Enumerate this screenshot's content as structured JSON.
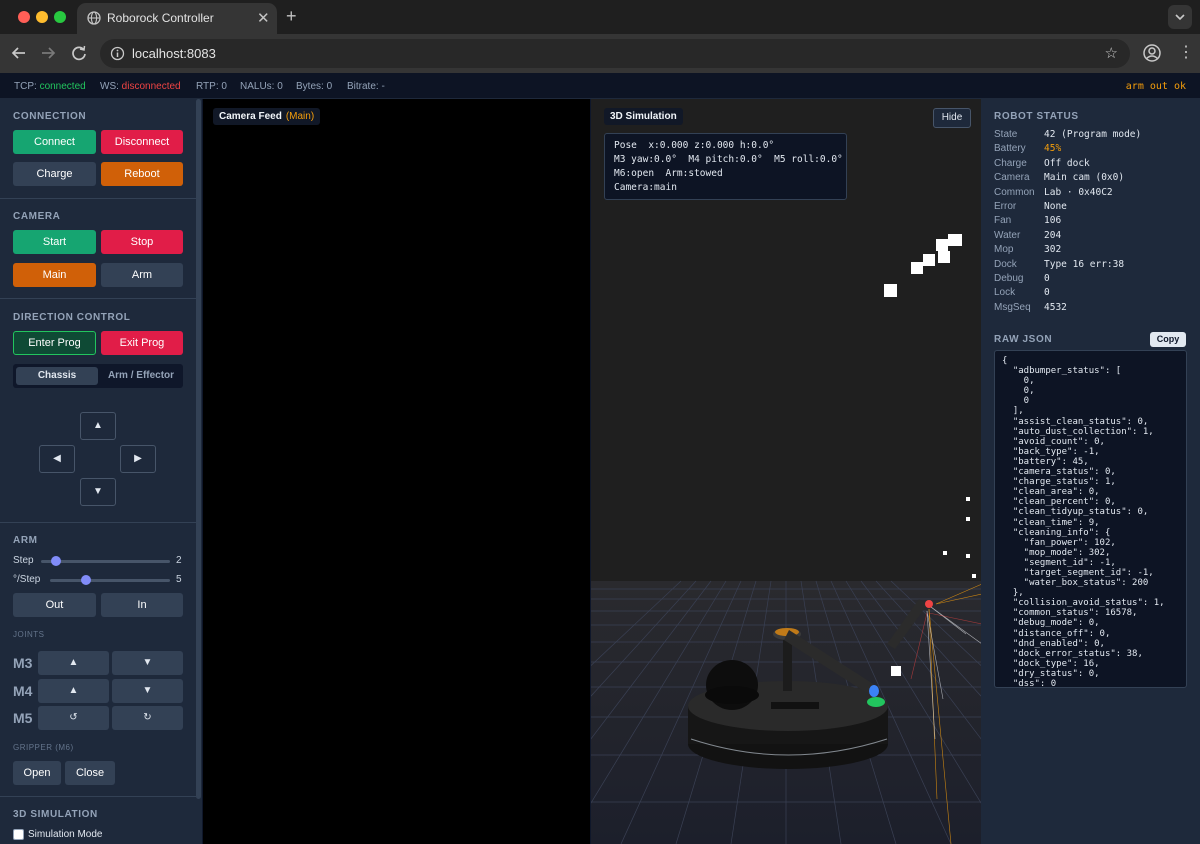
{
  "browser": {
    "tab_title": "Roborock Controller",
    "url": "localhost:8083",
    "tab_close": "✕",
    "new_tab": "+"
  },
  "statusbar": {
    "tcp_label": "TCP:",
    "tcp_value": "connected",
    "ws_label": "WS:",
    "ws_value": "disconnected",
    "rtp": "RTP: 0",
    "nalus": "NALUs: 0",
    "bytes": "Bytes: 0",
    "bitrate": "Bitrate: -",
    "arm_status": "arm out ok"
  },
  "connection": {
    "title": "CONNECTION",
    "connect": "Connect",
    "disconnect": "Disconnect",
    "charge": "Charge",
    "reboot": "Reboot"
  },
  "camera_ctrl": {
    "title": "CAMERA",
    "start": "Start",
    "stop": "Stop",
    "main": "Main",
    "arm": "Arm"
  },
  "direction": {
    "title": "DIRECTION CONTROL",
    "enter_prog": "Enter Prog",
    "exit_prog": "Exit Prog",
    "tab_chassis": "Chassis",
    "tab_arm": "Arm / Effector",
    "up": "▲",
    "down": "▼",
    "left": "◀",
    "right": "▶"
  },
  "arm": {
    "title": "ARM",
    "step_label": "Step",
    "step_value": "2",
    "step_fraction": 0.12,
    "deg_label": "°/Step",
    "deg_value": "5",
    "deg_fraction": 0.3,
    "out": "Out",
    "in": "In",
    "joints_title": "JOINTS",
    "joints": [
      {
        "name": "M3",
        "a": "▲",
        "b": "▼"
      },
      {
        "name": "M4",
        "a": "▲",
        "b": "▼"
      },
      {
        "name": "M5",
        "a": "↺",
        "b": "↻"
      }
    ],
    "gripper_title": "GRIPPER (M6)",
    "open": "Open",
    "close": "Close"
  },
  "simulation_ctrl": {
    "title": "3D SIMULATION",
    "mode_label": "Simulation Mode"
  },
  "camera_feed": {
    "label": "Camera Feed",
    "sub": "(Main)"
  },
  "sim": {
    "label": "3D Simulation",
    "hide": "Hide",
    "pose_lines": [
      "Pose  x:0.000 z:0.000 h:0.0°",
      "M3 yaw:0.0°  M4 pitch:0.0°  M5 roll:0.0°",
      "M6:open  Arm:stowed",
      "Camera:main"
    ]
  },
  "robot_status": {
    "title": "ROBOT STATUS",
    "rows": [
      {
        "key": "State",
        "value": "42 (Program mode)"
      },
      {
        "key": "Battery",
        "value": "45%"
      },
      {
        "key": "Charge",
        "value": "Off dock"
      },
      {
        "key": "Camera",
        "value": "Main cam (0x0)"
      },
      {
        "key": "Common",
        "value": "Lab · 0x40C2"
      },
      {
        "key": "Error",
        "value": "None"
      },
      {
        "key": "Fan",
        "value": "106"
      },
      {
        "key": "Water",
        "value": "204"
      },
      {
        "key": "Mop",
        "value": "302"
      },
      {
        "key": "Dock",
        "value": "Type 16 err:38"
      },
      {
        "key": "Debug",
        "value": "0"
      },
      {
        "key": "Lock",
        "value": "0"
      },
      {
        "key": "MsgSeq",
        "value": "4532"
      }
    ],
    "battery_color": "#f59e0b"
  },
  "raw_json": {
    "title": "RAW JSON",
    "copy": "Copy",
    "lines": [
      "{",
      "  \"adbumper_status\": [",
      "    0,",
      "    0,",
      "    0",
      "  ],",
      "  \"assist_clean_status\": 0,",
      "  \"auto_dust_collection\": 1,",
      "  \"avoid_count\": 0,",
      "  \"back_type\": -1,",
      "  \"battery\": 45,",
      "  \"camera_status\": 0,",
      "  \"charge_status\": 1,",
      "  \"clean_area\": 0,",
      "  \"clean_percent\": 0,",
      "  \"clean_tidyup_status\": 0,",
      "  \"clean_time\": 9,",
      "  \"cleaning_info\": {",
      "    \"fan_power\": 102,",
      "    \"mop_mode\": 302,",
      "    \"segment_id\": -1,",
      "    \"target_segment_id\": -1,",
      "    \"water_box_status\": 200",
      "  },",
      "  \"collision_avoid_status\": 1,",
      "  \"common_status\": 16578,",
      "  \"debug_mode\": 0,",
      "  \"distance_off\": 0,",
      "  \"dnd_enabled\": 0,",
      "  \"dock_error_status\": 38,",
      "  \"dock_type\": 16,",
      "  \"dry_status\": 0,",
      "  \"dss\": 0"
    ]
  }
}
